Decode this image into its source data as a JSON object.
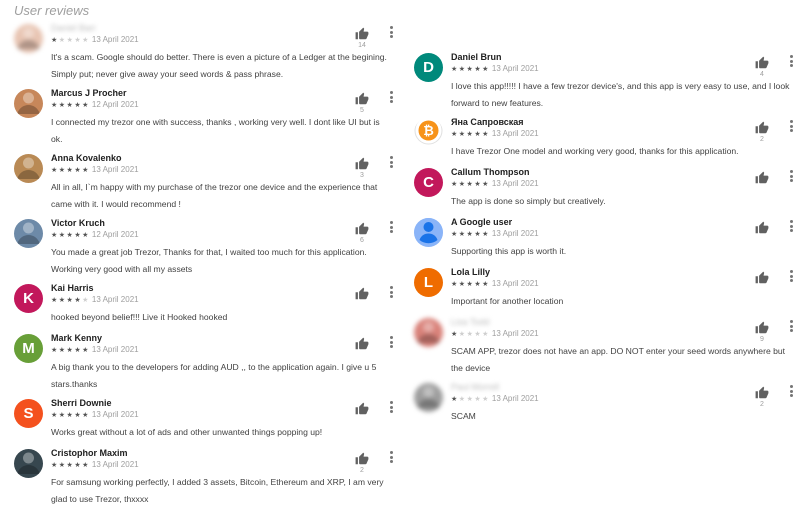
{
  "header": {
    "title": "User reviews"
  },
  "icons": {
    "thumb": "thumbs-up-icon",
    "more": "more-vert-icon",
    "bitcoin": "bitcoin-icon",
    "google_user": "person-icon"
  },
  "left_reviews": [
    {
      "name": "Daniel Barr",
      "blurred": true,
      "avatar_letter": "",
      "avatar_color": "#e8c5b3",
      "rating": 1,
      "date": "13 April 2021",
      "likes": "14",
      "text": "It's a scam. Google should do better. There is even a picture of a Ledger at the begining. Simply put; never give away your seed words & pass phrase."
    },
    {
      "name": "Marcus J Procher",
      "blurred": false,
      "avatar_letter": "",
      "avatar_color": "#c7875a",
      "rating": 5,
      "date": "12 April 2021",
      "likes": "5",
      "text": "I connected my trezor one with success, thanks , working very well. I dont like UI but is ok."
    },
    {
      "name": "Anna Kovalenko",
      "blurred": false,
      "avatar_letter": "",
      "avatar_color": "#b98a55",
      "rating": 5,
      "date": "13 April 2021",
      "likes": "3",
      "text": "All in all, I`m happy with my purchase of the trezor one device and the experience that came with it. I would recommend !"
    },
    {
      "name": "Victor Kruch",
      "blurred": false,
      "avatar_letter": "",
      "avatar_color": "#6d8aa8",
      "rating": 5,
      "date": "12 April 2021",
      "likes": "6",
      "text": "You made a great job Trezor, Thanks for that, I waited too much for this application. Working very good with all my assets"
    },
    {
      "name": "Kai Harris",
      "blurred": false,
      "avatar_letter": "K",
      "avatar_color": "#c2185b",
      "rating": 4,
      "date": "13 April 2021",
      "likes": "",
      "text": "hooked beyond belief!!! Live it Hooked hooked"
    },
    {
      "name": "Mark Kenny",
      "blurred": false,
      "avatar_letter": "M",
      "avatar_color": "#689f38",
      "rating": 5,
      "date": "13 April 2021",
      "likes": "",
      "text": "A big thank you to the developers for adding AUD ,, to the application again. I give u 5 stars.thanks"
    },
    {
      "name": "Sherri Downie",
      "blurred": false,
      "avatar_letter": "S",
      "avatar_color": "#f4511e",
      "rating": 5,
      "date": "13 April 2021",
      "likes": "",
      "text": "Works great without a lot of ads and other unwanted things popping up!"
    },
    {
      "name": "Cristophor Maxim",
      "blurred": false,
      "avatar_letter": "",
      "avatar_color": "#37474f",
      "rating": 5,
      "date": "13 April 2021",
      "likes": "2",
      "text": "For samsung working perfectly, I added 3 assets, Bitcoin, Ethereum and XRP, I am very glad to use Trezor, thxxxx"
    }
  ],
  "right_reviews": [
    {
      "name": "Daniel Brun",
      "blurred": false,
      "avatar_letter": "D",
      "avatar_color": "#00897b",
      "rating": 5,
      "date": "13 April 2021",
      "likes": "4",
      "text": "I love this app!!!!! I have a few trezor device's, and this app is very easy to use, and I look forward to new features."
    },
    {
      "name": "Яна Сапровская",
      "blurred": false,
      "avatar_letter": "",
      "avatar_color": "#ffffff",
      "rating": 5,
      "date": "13 April 2021",
      "likes": "2",
      "text": "I have Trezor One model and working very good, thanks for this application."
    },
    {
      "name": "Callum Thompson",
      "blurred": false,
      "avatar_letter": "C",
      "avatar_color": "#c2185b",
      "rating": 5,
      "date": "13 April 2021",
      "likes": "",
      "text": "The app is done so simply but creatively."
    },
    {
      "name": "A Google user",
      "blurred": false,
      "avatar_letter": "",
      "avatar_color": "#8ab4f8",
      "rating": 5,
      "date": "13 April 2021",
      "likes": "",
      "text": "Supporting this app is worth it."
    },
    {
      "name": "Lola Lilly",
      "blurred": false,
      "avatar_letter": "L",
      "avatar_color": "#ef6c00",
      "rating": 5,
      "date": "13 April 2021",
      "likes": "",
      "text": "Important for another location"
    },
    {
      "name": "Lisa Todd",
      "blurred": true,
      "avatar_letter": "",
      "avatar_color": "#d9827a",
      "rating": 1,
      "date": "13 April 2021",
      "likes": "9",
      "text": "SCAM APP, trezor does not have an app. DO NOT enter your seed words anywhere but the device"
    },
    {
      "name": "Paul Morrell",
      "blurred": true,
      "avatar_letter": "",
      "avatar_color": "#9e9e9e",
      "rating": 1,
      "date": "13 April 2021",
      "likes": "2",
      "text": "SCAM"
    }
  ]
}
